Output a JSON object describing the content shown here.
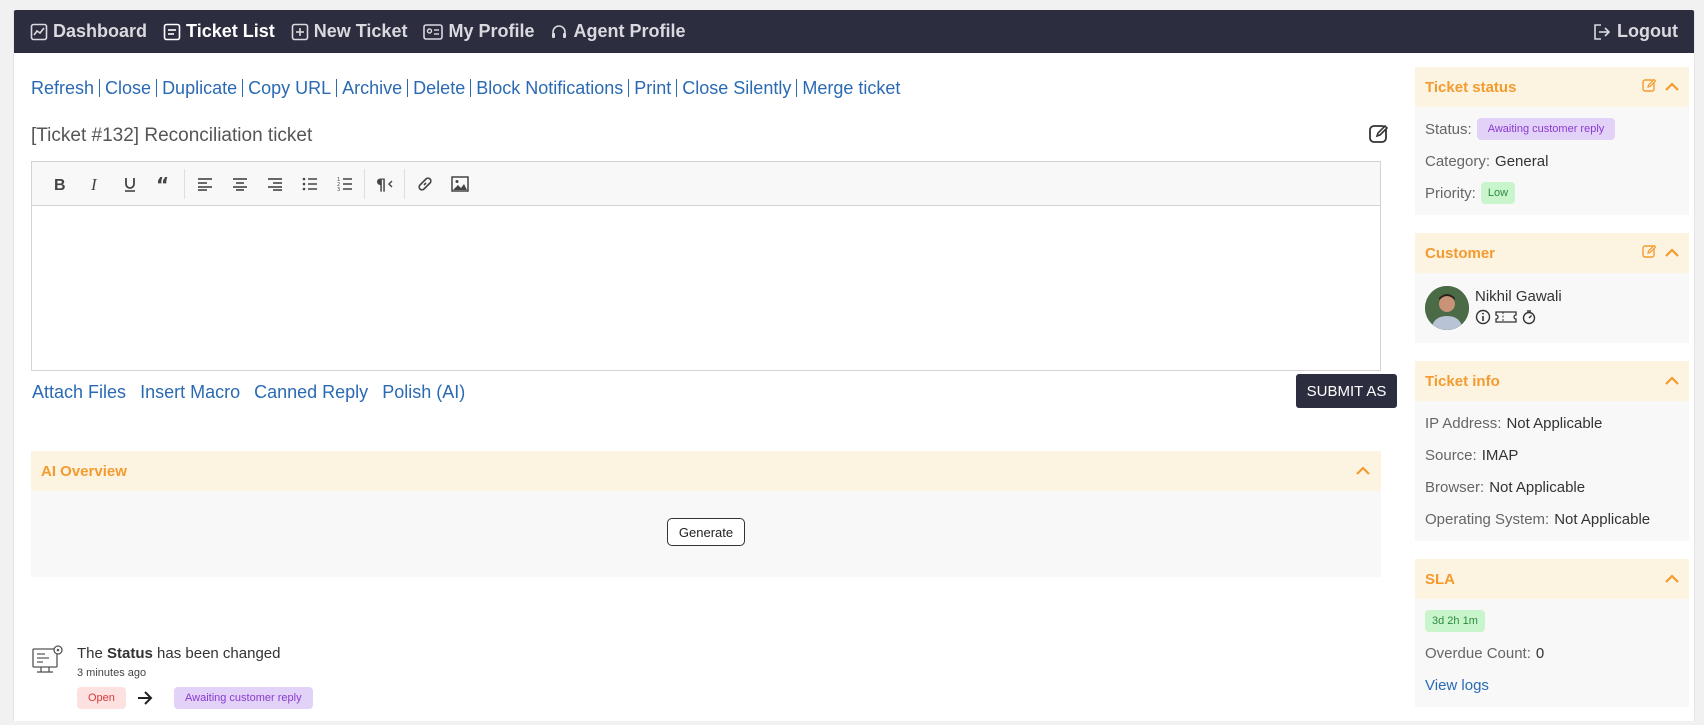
{
  "nav": {
    "dashboard": "Dashboard",
    "ticket_list": "Ticket List",
    "new_ticket": "New Ticket",
    "my_profile": "My Profile",
    "agent_profile": "Agent Profile",
    "logout": "Logout"
  },
  "actions": [
    "Refresh",
    "Close",
    "Duplicate",
    "Copy URL",
    "Archive",
    "Delete",
    "Block Notifications",
    "Print",
    "Close Silently",
    "Merge ticket"
  ],
  "ticket": {
    "title": "[Ticket #132] Reconciliation ticket"
  },
  "editor": {
    "attach_files": "Attach Files",
    "insert_macro": "Insert Macro",
    "canned_reply": "Canned Reply",
    "polish_ai": "Polish (AI)",
    "submit_label": "SUBMIT AS"
  },
  "ai_overview": {
    "title": "AI Overview",
    "generate_label": "Generate"
  },
  "activity": {
    "prefix": "The ",
    "field": "Status",
    "suffix": " has been changed",
    "time": "3 minutes ago",
    "from": "Open",
    "to": "Awaiting customer reply"
  },
  "sidebar": {
    "ticket_status": {
      "title": "Ticket status",
      "status_label": "Status:",
      "status_value": "Awaiting customer reply",
      "category_label": "Category:",
      "category_value": "General",
      "priority_label": "Priority:",
      "priority_value": "Low"
    },
    "customer": {
      "title": "Customer",
      "name": "Nikhil Gawali"
    },
    "ticket_info": {
      "title": "Ticket info",
      "ip_label": "IP Address:",
      "ip_value": "Not Applicable",
      "source_label": "Source:",
      "source_value": "IMAP",
      "browser_label": "Browser:",
      "browser_value": "Not Applicable",
      "os_label": "Operating System:",
      "os_value": "Not Applicable"
    },
    "sla": {
      "title": "SLA",
      "time_badge": "3d 2h 1m",
      "overdue_label": "Overdue Count:",
      "overdue_value": "0",
      "view_logs": "View logs"
    }
  },
  "colors": {
    "nav_bg": "#2c2d3f",
    "accent_orange": "#f39b2f",
    "link_blue": "#2a6ab3",
    "header_bg": "#fdf3e1"
  }
}
